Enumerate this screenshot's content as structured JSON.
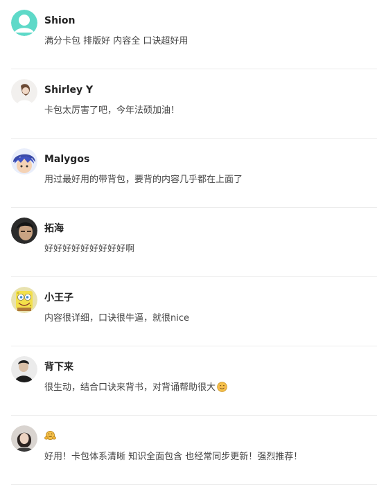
{
  "comments": [
    {
      "name": "Shion",
      "text": "满分卡包 排版好 内容全 口诀超好用",
      "avatar": "default-user-avatar",
      "avatar_color": "#5ed9c8"
    },
    {
      "name": "Shirley Y",
      "text": "卡包太厉害了吧，今年法硕加油！",
      "avatar": "photo-avatar"
    },
    {
      "name": "Malygos",
      "text": "用过最好用的带背包，要背的内容几乎都在上面了",
      "avatar": "anime-avatar"
    },
    {
      "name": "拓海",
      "text": "好好好好好好好好好啊",
      "avatar": "photo-avatar"
    },
    {
      "name": "小王子",
      "text": "内容很详细，口诀很牛逼，就很nice",
      "avatar": "spongebob-avatar"
    },
    {
      "name": "背下来",
      "text": "很生动，结合口诀来背书，对背诵帮助很大",
      "avatar": "photo-avatar",
      "trailing_emoji": "smiling-face-emoji"
    },
    {
      "name": "",
      "name_emoji": "hugging-face-emoji",
      "text": "好用！卡包体系清晰 知识全面包含 也经常同步更新！强烈推荐！",
      "avatar": "photo-avatar"
    }
  ],
  "colors": {
    "name": "#222222",
    "text": "#444444",
    "divider": "#ececec",
    "default_avatar": "#5ed9c8"
  }
}
